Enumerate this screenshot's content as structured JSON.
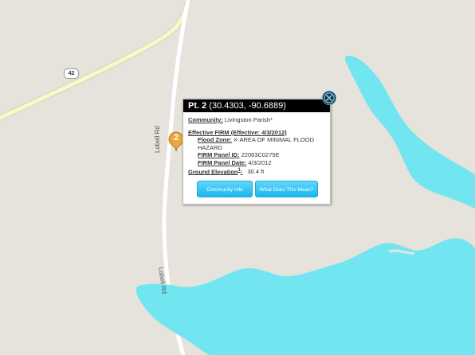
{
  "map": {
    "highway_number": "42",
    "road_labels": [
      "Lobell Rd",
      "Lobell Rd"
    ]
  },
  "marker": {
    "number": "2"
  },
  "popup": {
    "title_prefix": "Pt. 2",
    "coordinates": "(30.4303, -90.6889)",
    "community_label": "Community:",
    "community_value": "Livingston Parish*",
    "firm_label": "Effective FIRM (Effective:  4/3/2012)",
    "flood_zone_label": "Flood Zone:",
    "flood_zone_value": "X-AREA OF MINIMAL FLOOD HAZARD",
    "panel_id_label": "FIRM Panel ID:",
    "panel_id_value": "22063C0275E",
    "panel_date_label": "FIRM Panel Date:",
    "panel_date_value": "4/3/2012",
    "elevation_label": "Ground Elevation",
    "elevation_sup": "1",
    "elevation_colon": ":",
    "elevation_value": "30.4 ft",
    "buttons": {
      "community_info": "Community Info",
      "what_does_this_mean": "What Does This Mean?"
    }
  },
  "colors": {
    "land": "#e6e3dd",
    "water": "#72e6f0",
    "highway": "#fbf8c8",
    "road": "#ffffff",
    "marker": "#e8a83a",
    "button": "#1ab8ee"
  },
  "icons": {
    "close": "close-x-circle-icon",
    "marker": "map-pin-icon"
  }
}
